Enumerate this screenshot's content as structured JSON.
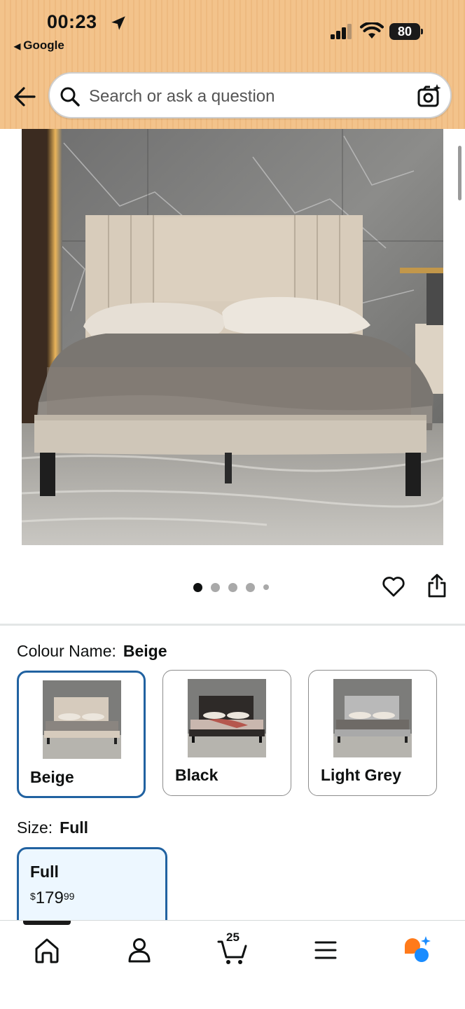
{
  "status_bar": {
    "time": "00:23",
    "back_app": "Google",
    "battery": "80"
  },
  "header": {
    "search_placeholder": "Search or ask a question",
    "icons": [
      "back-arrow-icon",
      "search-icon",
      "camera-search-icon"
    ]
  },
  "gallery": {
    "image_count": 5,
    "active_index": 0
  },
  "colour": {
    "label": "Colour Name:",
    "selected": "Beige",
    "options": [
      {
        "name": "Beige",
        "color": "#d6cbbd",
        "selected": true
      },
      {
        "name": "Black",
        "color": "#2e2a28",
        "selected": false
      },
      {
        "name": "Light Grey",
        "color": "#b9b9b9",
        "selected": false
      }
    ]
  },
  "size": {
    "label": "Size:",
    "selected": "Full",
    "options": [
      {
        "name": "Full",
        "currency": "$",
        "price_whole": "179",
        "price_cents": "99",
        "selected": true
      }
    ]
  },
  "bottom_nav": {
    "items": [
      "home-icon",
      "account-icon",
      "cart-icon",
      "menu-icon",
      "rufus-assistant-icon"
    ],
    "cart_count": "25"
  },
  "colors": {
    "header_bg": "#f3c38b",
    "selected_border": "#2162a1",
    "selected_bg": "#edf7ff",
    "rufus_orange": "#ff7a1a",
    "rufus_blue": "#1a8cff"
  }
}
